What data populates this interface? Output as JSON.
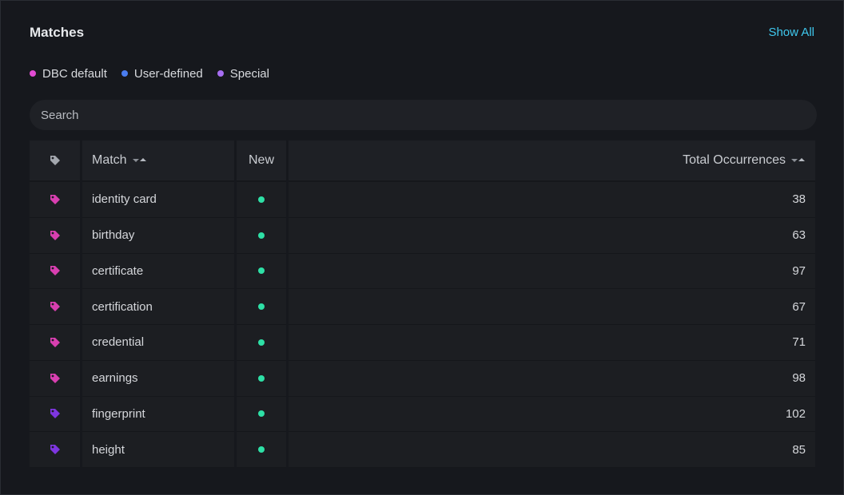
{
  "header": {
    "title": "Matches",
    "show_all_label": "Show All"
  },
  "legend": [
    {
      "label": "DBC default",
      "color": "#e24bd3"
    },
    {
      "label": "User-defined",
      "color": "#4a7df0"
    },
    {
      "label": "Special",
      "color": "#a76ef2"
    }
  ],
  "search": {
    "placeholder": "Search",
    "value": ""
  },
  "table": {
    "columns": {
      "tag_icon": "tag-icon",
      "match": "Match",
      "new": "New",
      "total": "Total Occurrences"
    },
    "new_dot_color": "#2ee0a6",
    "rows": [
      {
        "match": "identity card",
        "total": "38",
        "tag_color": "#d83fb0",
        "is_new": true
      },
      {
        "match": "birthday",
        "total": "63",
        "tag_color": "#d83fb0",
        "is_new": true
      },
      {
        "match": "certificate",
        "total": "97",
        "tag_color": "#d83fb0",
        "is_new": true
      },
      {
        "match": "certification",
        "total": "67",
        "tag_color": "#d83fb0",
        "is_new": true
      },
      {
        "match": "credential",
        "total": "71",
        "tag_color": "#d83fb0",
        "is_new": true
      },
      {
        "match": "earnings",
        "total": "98",
        "tag_color": "#d83fb0",
        "is_new": true
      },
      {
        "match": "fingerprint",
        "total": "102",
        "tag_color": "#7e36e0",
        "is_new": true
      },
      {
        "match": "height",
        "total": "85",
        "tag_color": "#7e36e0",
        "is_new": true
      }
    ]
  }
}
